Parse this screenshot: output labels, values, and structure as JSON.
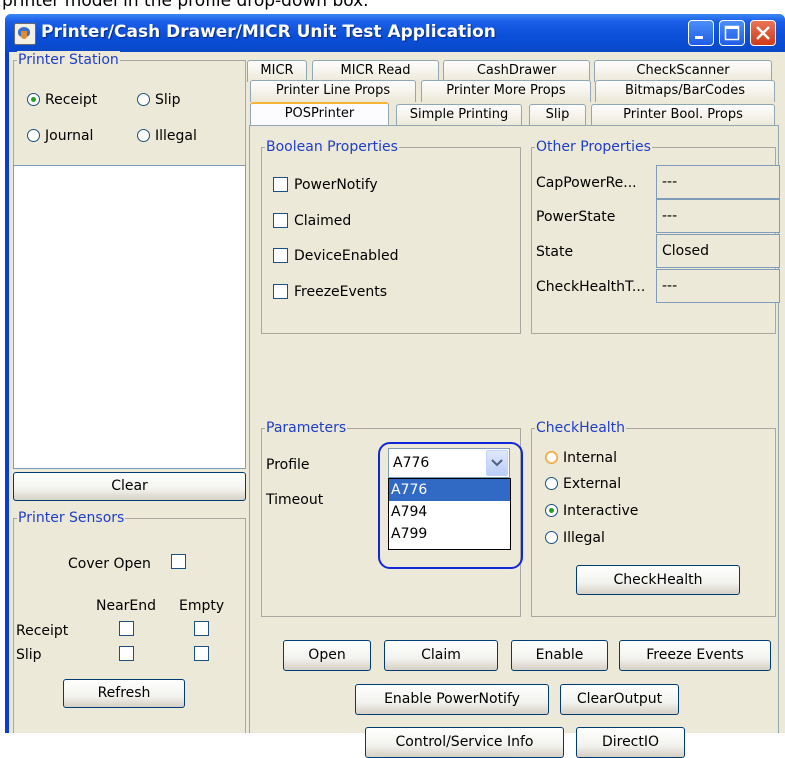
{
  "caption": "printer model in the profile drop-down box.",
  "window": {
    "title": "Printer/Cash Drawer/MICR Unit Test Application",
    "controls": [
      "minimize-icon",
      "maximize-icon",
      "close-icon"
    ]
  },
  "left": {
    "station_title": "Printer Station",
    "station_options": [
      {
        "label": "Receipt",
        "selected": true
      },
      {
        "label": "Slip",
        "selected": false
      },
      {
        "label": "Journal",
        "selected": false
      },
      {
        "label": "Illegal",
        "selected": false
      }
    ],
    "clear_label": "Clear",
    "sensors_title": "Printer Sensors",
    "cover_open_label": "Cover Open",
    "nearend_label": "NearEnd",
    "empty_label": "Empty",
    "receipt_label": "Receipt",
    "slip_label": "Slip",
    "refresh_label": "Refresh"
  },
  "tabs": {
    "row1": [
      "MICR",
      "MICR Read",
      "CashDrawer",
      "CheckScanner"
    ],
    "row2": [
      "Printer Line Props",
      "Printer More Props",
      "Bitmaps/BarCodes"
    ],
    "row3": [
      "POSPrinter",
      "Simple Printing",
      "Slip",
      "Printer Bool. Props"
    ],
    "selected": "POSPrinter"
  },
  "boolean": {
    "title": "Boolean Properties",
    "items": [
      "PowerNotify",
      "Claimed",
      "DeviceEnabled",
      "FreezeEvents"
    ]
  },
  "other": {
    "title": "Other Properties",
    "rows": [
      {
        "label": "CapPowerRe...",
        "value": "---"
      },
      {
        "label": "PowerState",
        "value": "---"
      },
      {
        "label": "State",
        "value": "Closed"
      },
      {
        "label": "CheckHealthT...",
        "value": "---"
      }
    ]
  },
  "parameters": {
    "title": "Parameters",
    "profile_label": "Profile",
    "profile_value": "A776",
    "timeout_label": "Timeout",
    "dropdown_options": [
      "A776",
      "A794",
      "A799"
    ],
    "dropdown_selected": "A776"
  },
  "checkhealth": {
    "title": "CheckHealth",
    "options": [
      {
        "label": "Internal",
        "selected": false
      },
      {
        "label": "External",
        "selected": false
      },
      {
        "label": "Interactive",
        "selected": true
      },
      {
        "label": "Illegal",
        "selected": false
      }
    ],
    "button_label": "CheckHealth"
  },
  "actions": {
    "open": "Open",
    "claim": "Claim",
    "enable": "Enable",
    "freeze": "Freeze Events",
    "enable_powernotify": "Enable PowerNotify",
    "clear_output": "ClearOutput",
    "control_info": "Control/Service Info",
    "directio": "DirectIO"
  },
  "colors": {
    "title_bar": "#0b4fd9",
    "group_title": "#1f3ec8",
    "highlight": "#1028d8",
    "panel": "#ece9d8"
  }
}
